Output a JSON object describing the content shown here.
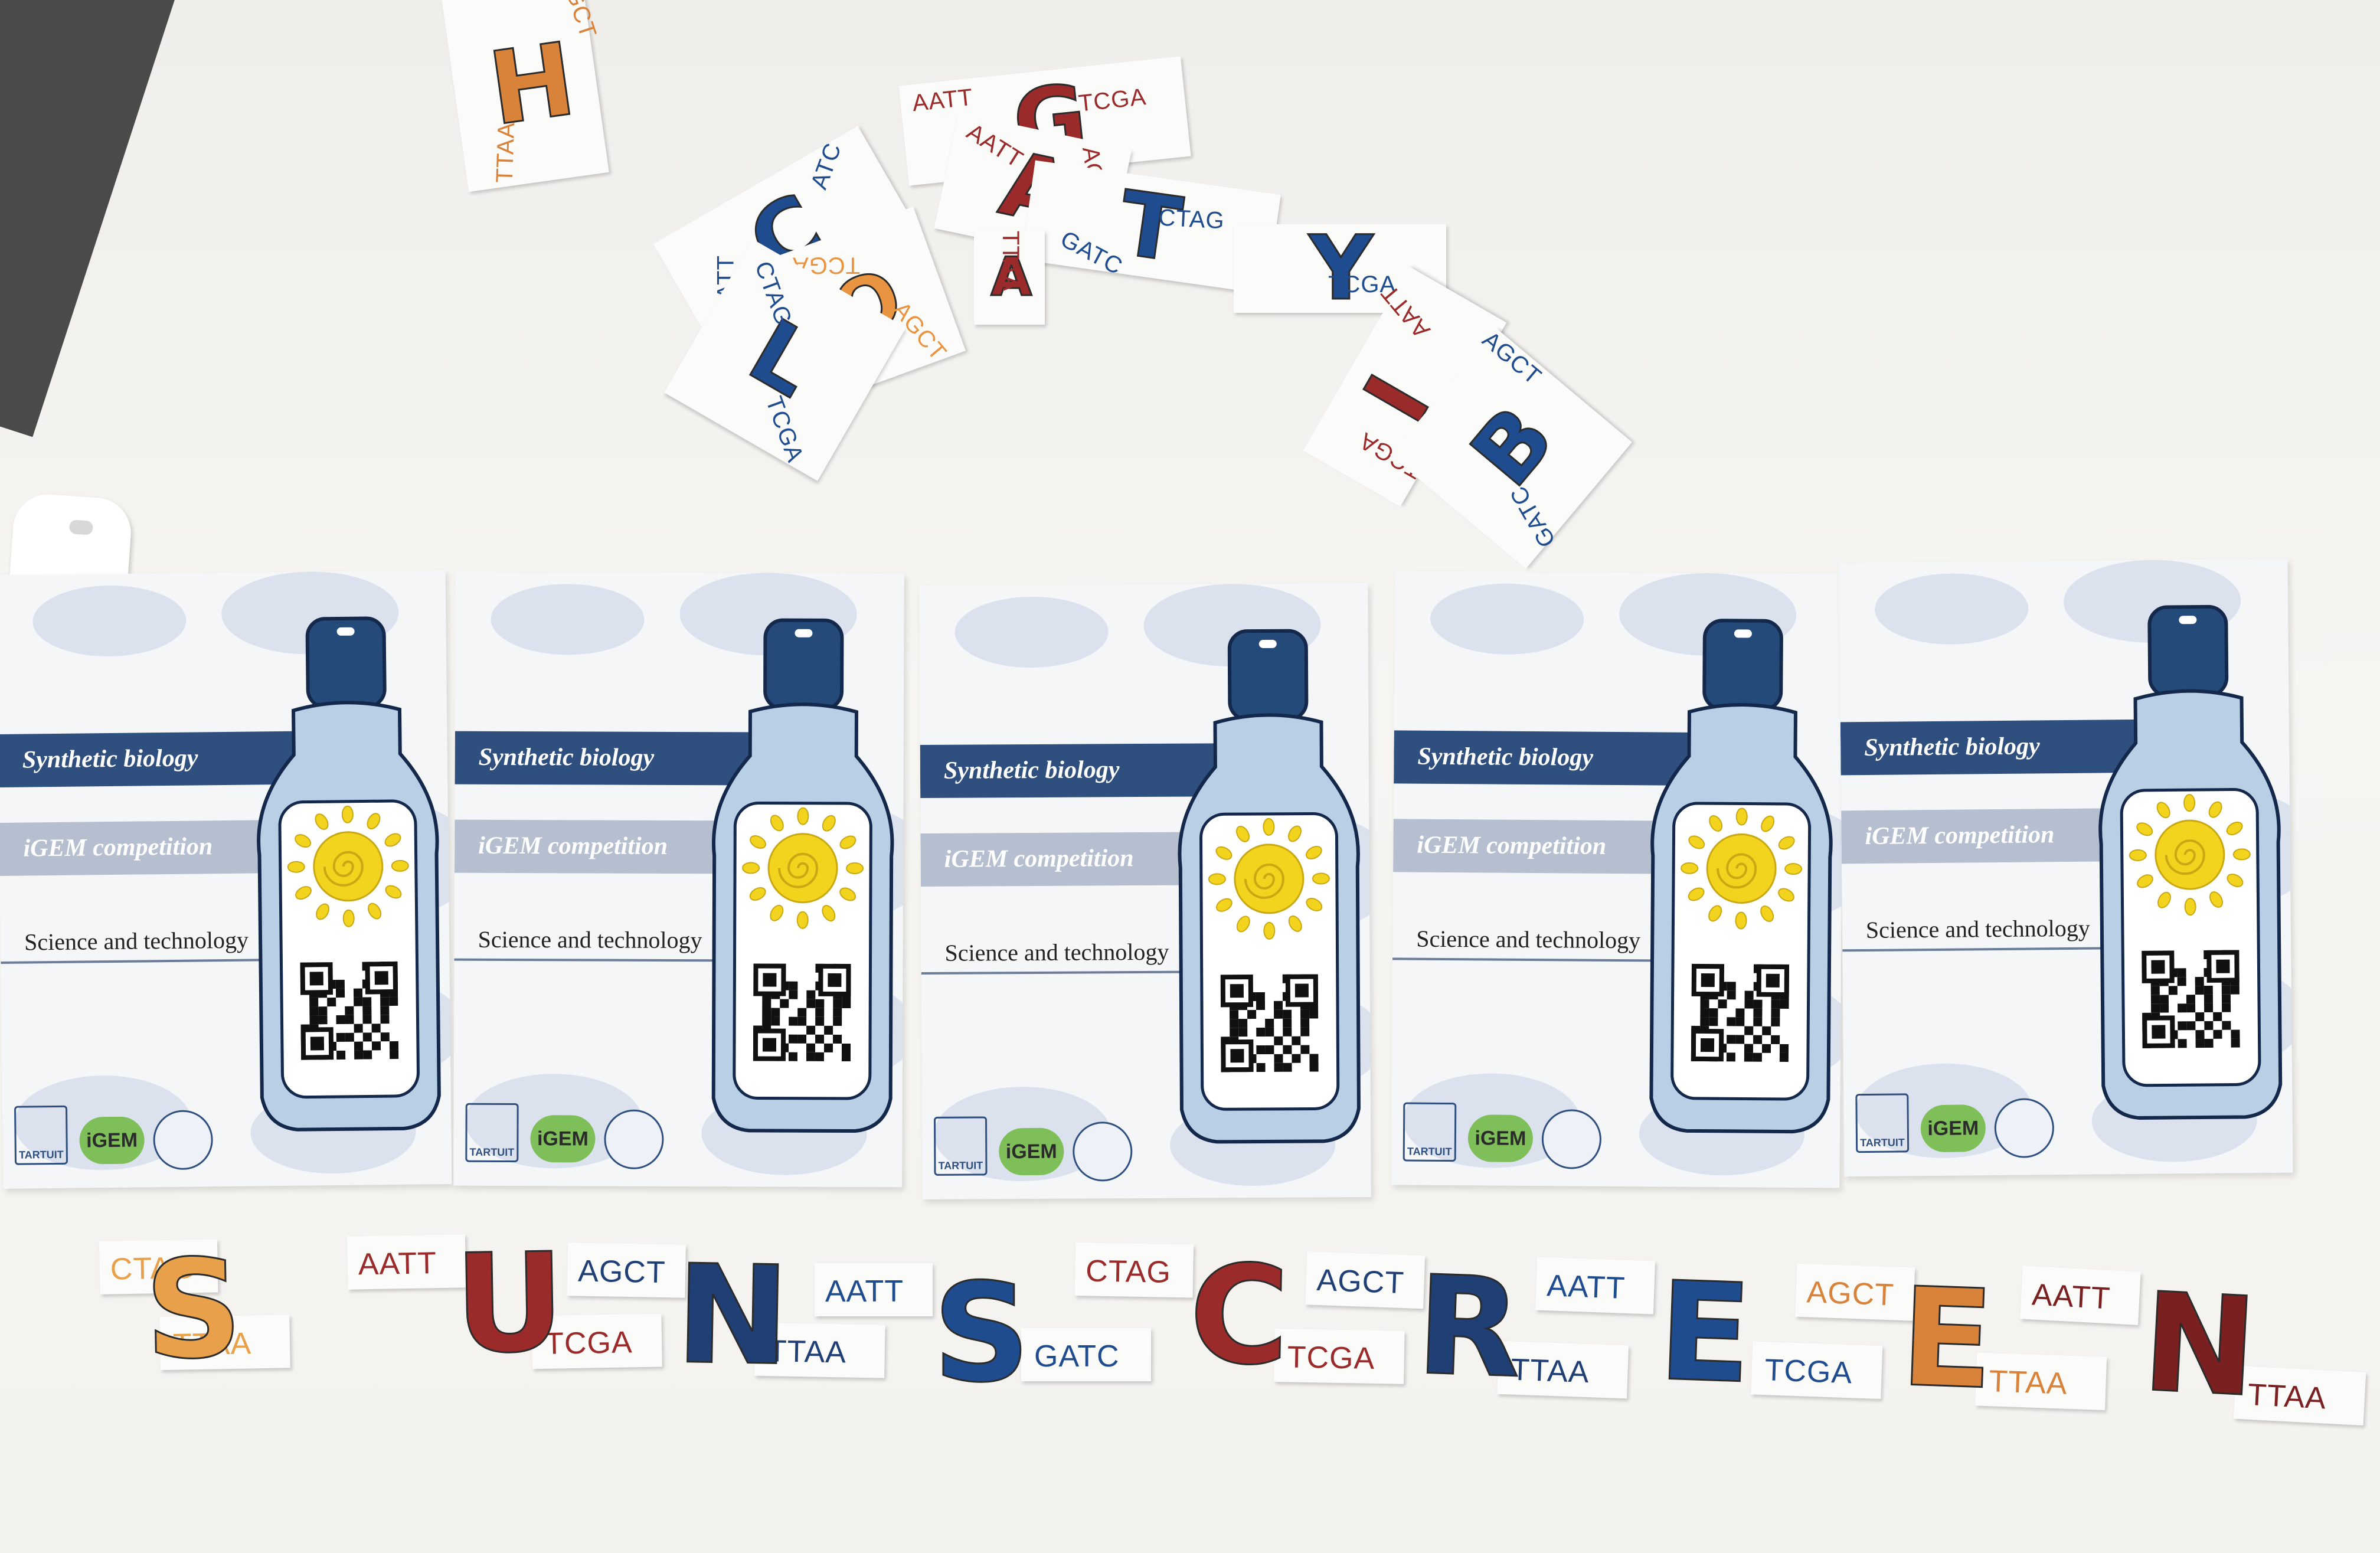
{
  "scene": {
    "top_letters": [
      {
        "letter": "H",
        "color": "#d9823a",
        "codes": [
          "AGCT",
          "TTAA"
        ]
      },
      {
        "letter": "G",
        "color": "#9b2b2b",
        "codes": [
          "AATT",
          "TCGA"
        ]
      },
      {
        "letter": "A",
        "color": "#9b2b2b",
        "codes": [
          "AATT",
          "AGC"
        ]
      },
      {
        "letter": "T",
        "color": "#1f4c8f",
        "codes": [
          "CTAG",
          "GATC"
        ]
      },
      {
        "letter": "Y",
        "color": "#1f4c8f",
        "codes": [
          "TCGA"
        ]
      },
      {
        "letter": "C",
        "color": "#1f4c8f",
        "codes": [
          "AATT",
          "ATC"
        ]
      },
      {
        "letter": "O",
        "color": "#e89440",
        "codes": [
          "TCGA",
          "AGCT"
        ]
      },
      {
        "letter": "L",
        "color": "#1f4c8f",
        "codes": [
          "CTAG",
          "TCGA"
        ]
      },
      {
        "letter": "I",
        "color": "#9b2b2b",
        "codes": [
          "TCGA",
          "AATT"
        ]
      },
      {
        "letter": "B",
        "color": "#1f4c8f",
        "codes": [
          "AGCT",
          "GATC"
        ]
      },
      {
        "letter": "A",
        "color": "#9b2b2b",
        "codes": [
          "TTAA"
        ]
      }
    ],
    "posters": [
      {
        "line1": "Synthetic biology",
        "line2": "iGEM competition",
        "line3": "Science and technology"
      },
      {
        "line1": "Synthetic biology",
        "line2": "iGEM competition",
        "line3": "Science and technology"
      },
      {
        "line1": "Synthetic biology",
        "line2": "iGEM competition",
        "line3": "Science and technology"
      },
      {
        "line1": "Synthetic biology",
        "line2": "iGEM competition",
        "line3": "Science and technology"
      },
      {
        "line1": "Synthetic biology",
        "line2": "iGEM competition",
        "line3": "Science and technology"
      }
    ],
    "poster_logos": {
      "team": "TARTUIT",
      "igem": "iGEM",
      "igem_prefix": "i"
    },
    "bottom_word": [
      {
        "letter": "S",
        "color": "#e8a04a",
        "codes": [
          "CTAG",
          "TTAA"
        ]
      },
      {
        "letter": "U",
        "color": "#9b2b2b",
        "codes": [
          "AATT",
          "TCGA"
        ]
      },
      {
        "letter": "N",
        "color": "#1f3f75",
        "codes": [
          "AGCT",
          "TTAA"
        ]
      },
      {
        "letter": "S",
        "color": "#1f4c8f",
        "codes": [
          "AATT",
          "GATC"
        ]
      },
      {
        "letter": "C",
        "color": "#9b2b2b",
        "codes": [
          "CTAG",
          "TCGA"
        ]
      },
      {
        "letter": "R",
        "color": "#1f3f75",
        "codes": [
          "AGCT",
          "TTAA"
        ]
      },
      {
        "letter": "E",
        "color": "#1f4c8f",
        "codes": [
          "AATT",
          "TCGA"
        ]
      },
      {
        "letter": "E",
        "color": "#d9823a",
        "codes": [
          "AGCT",
          "TTAA"
        ]
      },
      {
        "letter": "N",
        "color": "#7a2020",
        "codes": [
          "AATT",
          "TTAA"
        ]
      }
    ],
    "colors": {
      "navy": "#2f4f7f",
      "bottle": "#b9cfe6",
      "bottle_dark": "#244a7a",
      "sun": "#f2d41f",
      "sun_outline": "#caa814"
    }
  }
}
